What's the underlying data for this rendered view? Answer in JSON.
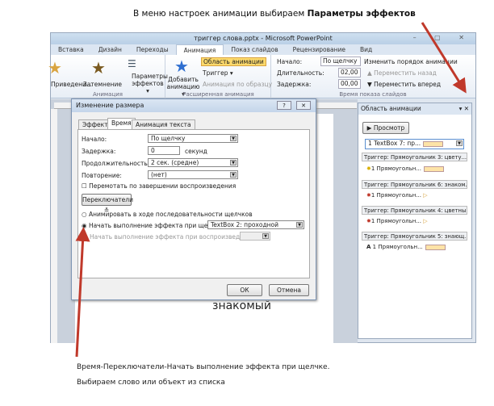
{
  "caption": {
    "text": "В меню настроек анимации выбираем ",
    "bold": "Параметры эффектов"
  },
  "window": {
    "title": "триггер слова.pptx - Microsoft PowerPoint",
    "controls": "– ▢ ✕"
  },
  "tabs": [
    "Вставка",
    "Дизайн",
    "Переходы",
    "Анимация",
    "Показ слайдов",
    "Рецензирование",
    "Вид"
  ],
  "ribbon": {
    "anim_items": [
      "Приведени...",
      "Затемнение"
    ],
    "params": "Параметры эффектов ▾",
    "group_anim": "Анимация",
    "add": "Добавить анимацию ▾",
    "pane_btn": "Область анимации",
    "trigger": "Триггер ▾",
    "painter": "Анимация по образцу",
    "group_ext": "Расширенная анимация",
    "start_lbl": "Начало:",
    "start_val": "По щелчку",
    "dur_lbl": "Длительность:",
    "dur_val": "02,00",
    "delay_lbl": "Задержка:",
    "delay_val": "00,00",
    "reorder": "Изменить порядок анимации",
    "back": "▲ Переместить назад",
    "fwd": "▼ Переместить вперед",
    "group_time": "Время показа слайдов"
  },
  "slide": {
    "word": "знакомый"
  },
  "dialog": {
    "title": "Изменение размера",
    "tabs": [
      "Эффект",
      "Время",
      "Анимация текста"
    ],
    "start_lbl": "Начало:",
    "start_val": "По щелчку",
    "delay_lbl": "Задержка:",
    "delay_val": "0",
    "delay_unit": "секунд",
    "dur_lbl": "Продолжительность:",
    "dur_val": "2 сек. (средне)",
    "repeat_lbl": "Повторение:",
    "repeat_val": "(нет)",
    "rewind": "Перемотать по завершении воспроизведения",
    "triggers_btn": "Переключатели ≛",
    "radio1": "Анимировать в ходе последовательности щелчков",
    "radio2": "Начать выполнение эффекта при щелчке",
    "radio2_val": "TextBox 2: проходной",
    "radio3": "Начать выполнение эффекта при воспроизведении:",
    "ok": "ОК",
    "cancel": "Отмена"
  },
  "pane": {
    "title": "Область анимации",
    "preview": "▶ Просмотр",
    "first": "1 TextBox 7: пр...",
    "groups": [
      {
        "trigger": "Триггер: Прямоугольник 3: цвету...",
        "item": "1 Прямоугольн..."
      },
      {
        "trigger": "Триггер: Прямоугольник 6: знаком...",
        "item": "1 Прямоугольн..."
      },
      {
        "trigger": "Триггер: Прямоугольник 4: цветный",
        "item": "1 Прямоугольн..."
      },
      {
        "trigger": "Триггер: Прямоугольник 5: знающ...",
        "item": "1 Прямоугольн..."
      }
    ]
  },
  "footer": {
    "line1": "Время-Переключатели-Начать выполнение эффекта  при щелчке.",
    "line2": "Выбираем слово или объект из списка"
  },
  "colors": {
    "arrow": "#c0392b",
    "highlight": "#fde3a7"
  }
}
